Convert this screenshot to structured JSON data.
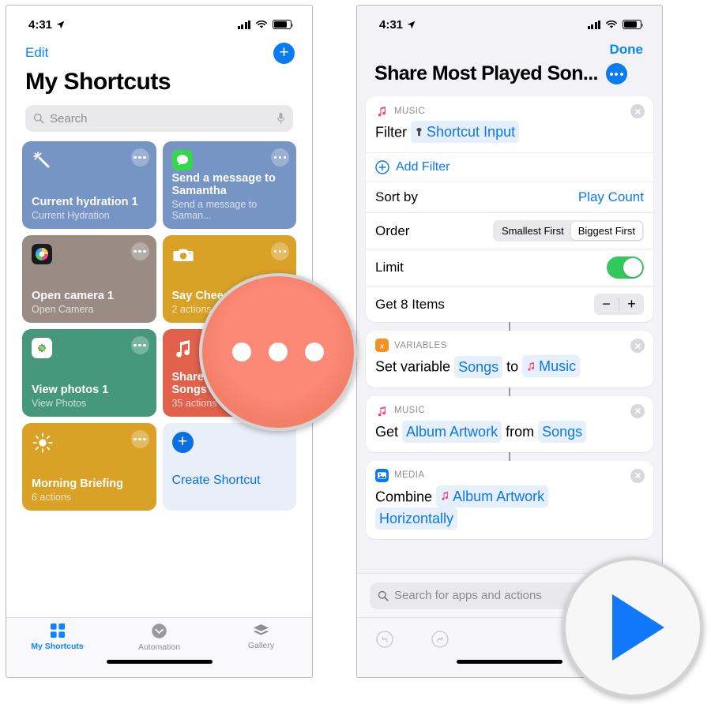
{
  "left_phone": {
    "status": {
      "time": "4:31",
      "location_icon": "location-arrow-icon",
      "cellular": "cellular-bars-icon",
      "wifi": "wifi-icon",
      "battery": "battery-icon"
    },
    "nav": {
      "edit_label": "Edit",
      "add_icon": "plus-circle-icon"
    },
    "title": "My Shortcuts",
    "search": {
      "placeholder": "Search",
      "search_icon": "search-icon",
      "mic_icon": "microphone-icon"
    },
    "tiles": [
      {
        "name": "Current hydration 1",
        "subtitle": "Current Hydration",
        "color": "#7694c4",
        "icon": "sparkle-wand-icon",
        "icon_type": "glyph"
      },
      {
        "name": "Send a message to Samantha",
        "subtitle": "Send a message to Saman...",
        "color": "#7694c4",
        "icon": "messages-app-icon",
        "icon_type": "app"
      },
      {
        "name": "Open camera 1",
        "subtitle": "Open Camera",
        "color": "#9a8c85",
        "icon": "halide-app-icon",
        "icon_type": "app"
      },
      {
        "name": "Say Cheese",
        "subtitle": "2 actions",
        "color": "#d9a126",
        "icon": "camera-icon",
        "icon_type": "glyph"
      },
      {
        "name": "View photos 1",
        "subtitle": "View Photos",
        "color": "#46987d",
        "icon": "photos-app-icon",
        "icon_type": "app"
      },
      {
        "name": "Share Most Played Songs",
        "subtitle": "35 actions",
        "color": "#e2614b",
        "icon": "music-note-icon",
        "icon_type": "glyph"
      },
      {
        "name": "Morning Briefing",
        "subtitle": "6 actions",
        "color": "#d9a126",
        "icon": "sun-icon",
        "icon_type": "glyph"
      }
    ],
    "create_tile": {
      "label": "Create Shortcut",
      "icon": "plus-circle-icon"
    },
    "tabbar": [
      {
        "label": "My Shortcuts",
        "icon": "grid-squares-icon",
        "active": true
      },
      {
        "label": "Automation",
        "icon": "clock-arrow-icon",
        "active": false
      },
      {
        "label": "Gallery",
        "icon": "layers-icon",
        "active": false
      }
    ]
  },
  "right_phone": {
    "status": {
      "time": "4:31",
      "location_icon": "location-arrow-icon"
    },
    "nav": {
      "done_label": "Done"
    },
    "title": "Share Most Played Son...",
    "title_menu_icon": "ellipsis-circle-icon",
    "cards": [
      {
        "category": "MUSIC",
        "category_icon": "music-app-icon",
        "close_icon": "close-circle-icon",
        "body_prefix": "Filter",
        "body_token": "Shortcut Input",
        "body_token_icon": "magic-variable-icon",
        "add_filter": {
          "label": "Add Filter",
          "icon": "plus-outline-icon"
        },
        "rows": [
          {
            "label": "Sort by",
            "value": "Play Count",
            "type": "link"
          },
          {
            "label": "Order",
            "type": "segmented",
            "options": [
              "Smallest First",
              "Biggest First"
            ],
            "selected": "Biggest First"
          },
          {
            "label": "Limit",
            "type": "toggle",
            "on": true
          },
          {
            "label": "Get 8 Items",
            "type": "stepper",
            "minus": "−",
            "plus": "+"
          }
        ]
      },
      {
        "category": "VARIABLES",
        "category_icon": "variables-x-icon",
        "close_icon": "close-circle-icon",
        "parts": [
          {
            "t": "text",
            "v": "Set variable"
          },
          {
            "t": "token",
            "v": "Songs"
          },
          {
            "t": "text",
            "v": "to"
          },
          {
            "t": "token",
            "v": "Music",
            "icon": "music-note-icon"
          }
        ]
      },
      {
        "category": "MUSIC",
        "category_icon": "music-app-icon",
        "close_icon": "close-circle-icon",
        "parts": [
          {
            "t": "text",
            "v": "Get"
          },
          {
            "t": "token",
            "v": "Album Artwork"
          },
          {
            "t": "text",
            "v": "from"
          },
          {
            "t": "token",
            "v": "Songs"
          }
        ]
      },
      {
        "category": "MEDIA",
        "category_icon": "media-app-icon",
        "close_icon": "close-circle-icon",
        "parts": [
          {
            "t": "text",
            "v": "Combine"
          },
          {
            "t": "token",
            "v": "Album Artwork",
            "icon": "music-note-icon"
          },
          {
            "t": "token",
            "v": "Horizontally"
          }
        ]
      }
    ],
    "bottom_search": {
      "placeholder": "Search for apps and actions",
      "search_icon": "search-icon"
    },
    "toolbar": {
      "undo_icon": "undo-circle-icon",
      "redo_icon": "redo-circle-icon"
    }
  },
  "callouts": {
    "dots": {
      "icon": "ellipsis-icon",
      "color": "#f4806a"
    },
    "play": {
      "icon": "play-triangle-icon",
      "color": "#1278fb"
    }
  }
}
